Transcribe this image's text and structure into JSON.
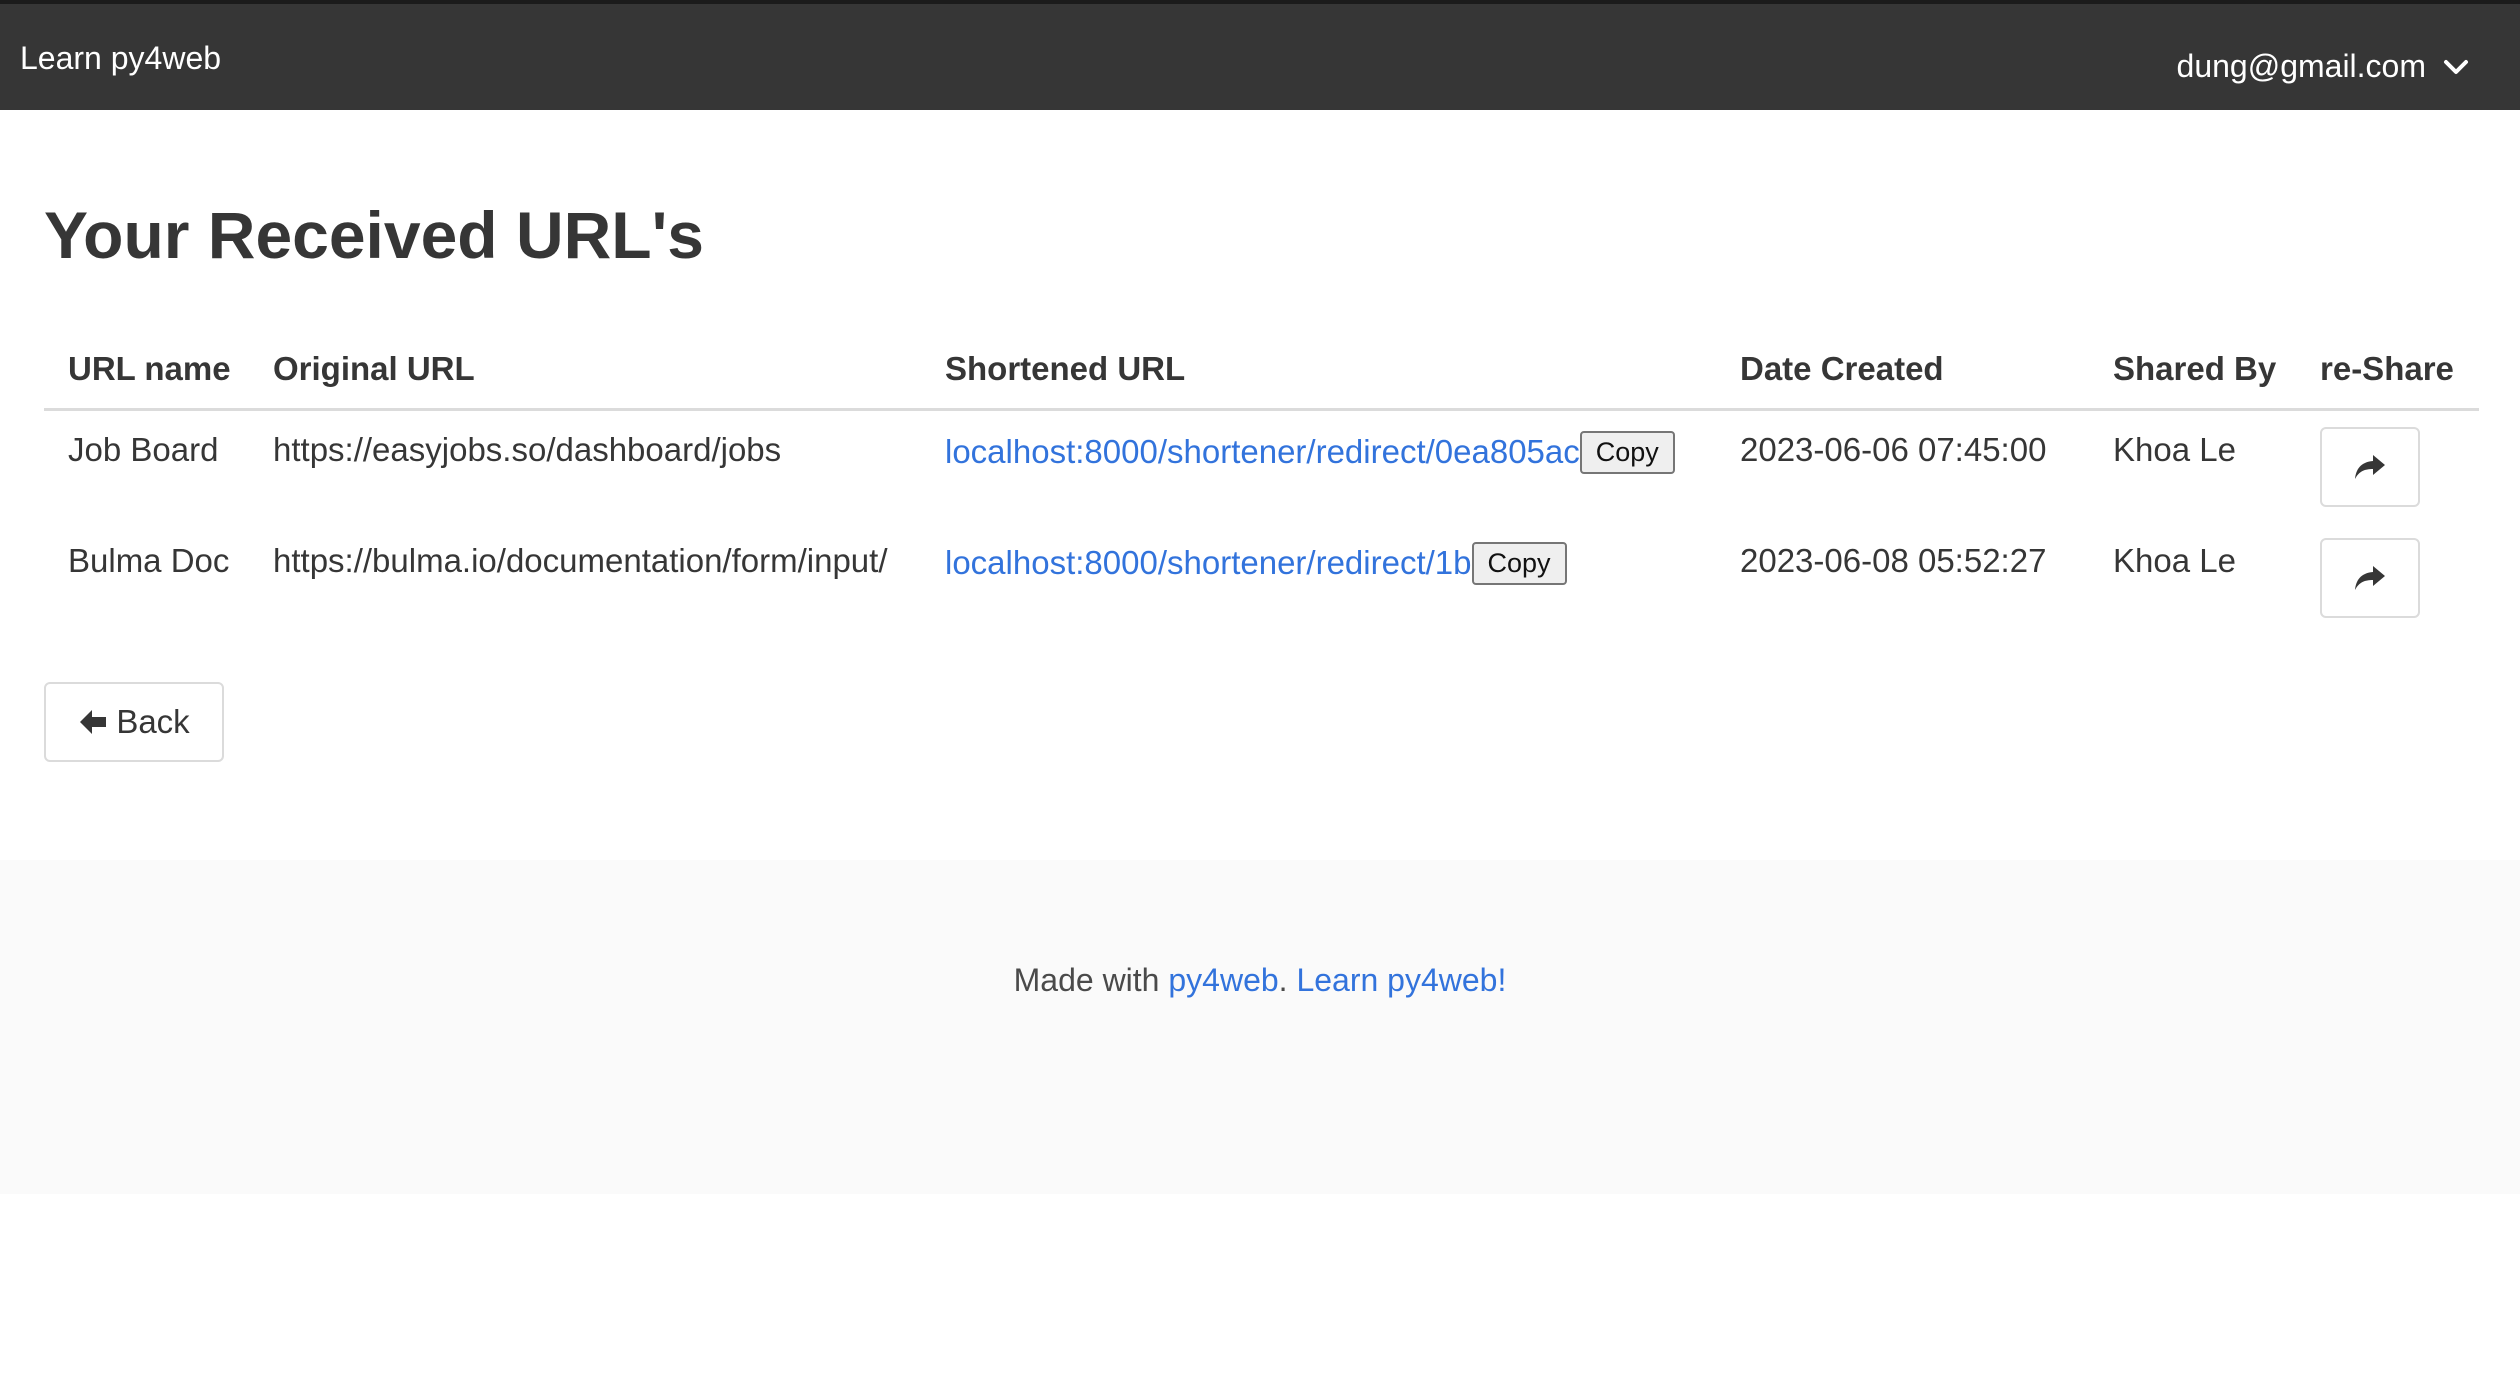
{
  "navbar": {
    "brand": "Learn py4web",
    "user_email": "dung@gmail.com",
    "dropdown_icon": "chevron-down-icon"
  },
  "page": {
    "title": "Your Received URL's"
  },
  "table": {
    "columns": [
      "URL name",
      "Original URL",
      "Shortened URL",
      "Date Created",
      "Shared By",
      "re-Share"
    ],
    "rows": [
      {
        "name": "Job Board",
        "original": "https://easyjobs.so/dashboard/jobs",
        "shortened": "localhost:8000/shortener/redirect/0ea805ac",
        "copy_label": "Copy",
        "date": "2023-06-06 07:45:00",
        "shared_by": "Khoa Le",
        "share_icon": "share-arrow-icon"
      },
      {
        "name": "Bulma Doc",
        "original": "https://bulma.io/documentation/form/input/",
        "shortened": "localhost:8000/shortener/redirect/1b",
        "copy_label": "Copy",
        "date": "2023-06-08 05:52:27",
        "shared_by": "Khoa Le",
        "share_icon": "share-arrow-icon"
      }
    ]
  },
  "back_button": {
    "label": "Back",
    "icon": "arrow-left-icon"
  },
  "footer": {
    "prefix": "Made with ",
    "link1": "py4web",
    "separator": ". ",
    "link2": "Learn py4web!"
  },
  "colors": {
    "navbar": "#363636",
    "link": "#3273dc",
    "footer_bg": "#fafafa"
  }
}
